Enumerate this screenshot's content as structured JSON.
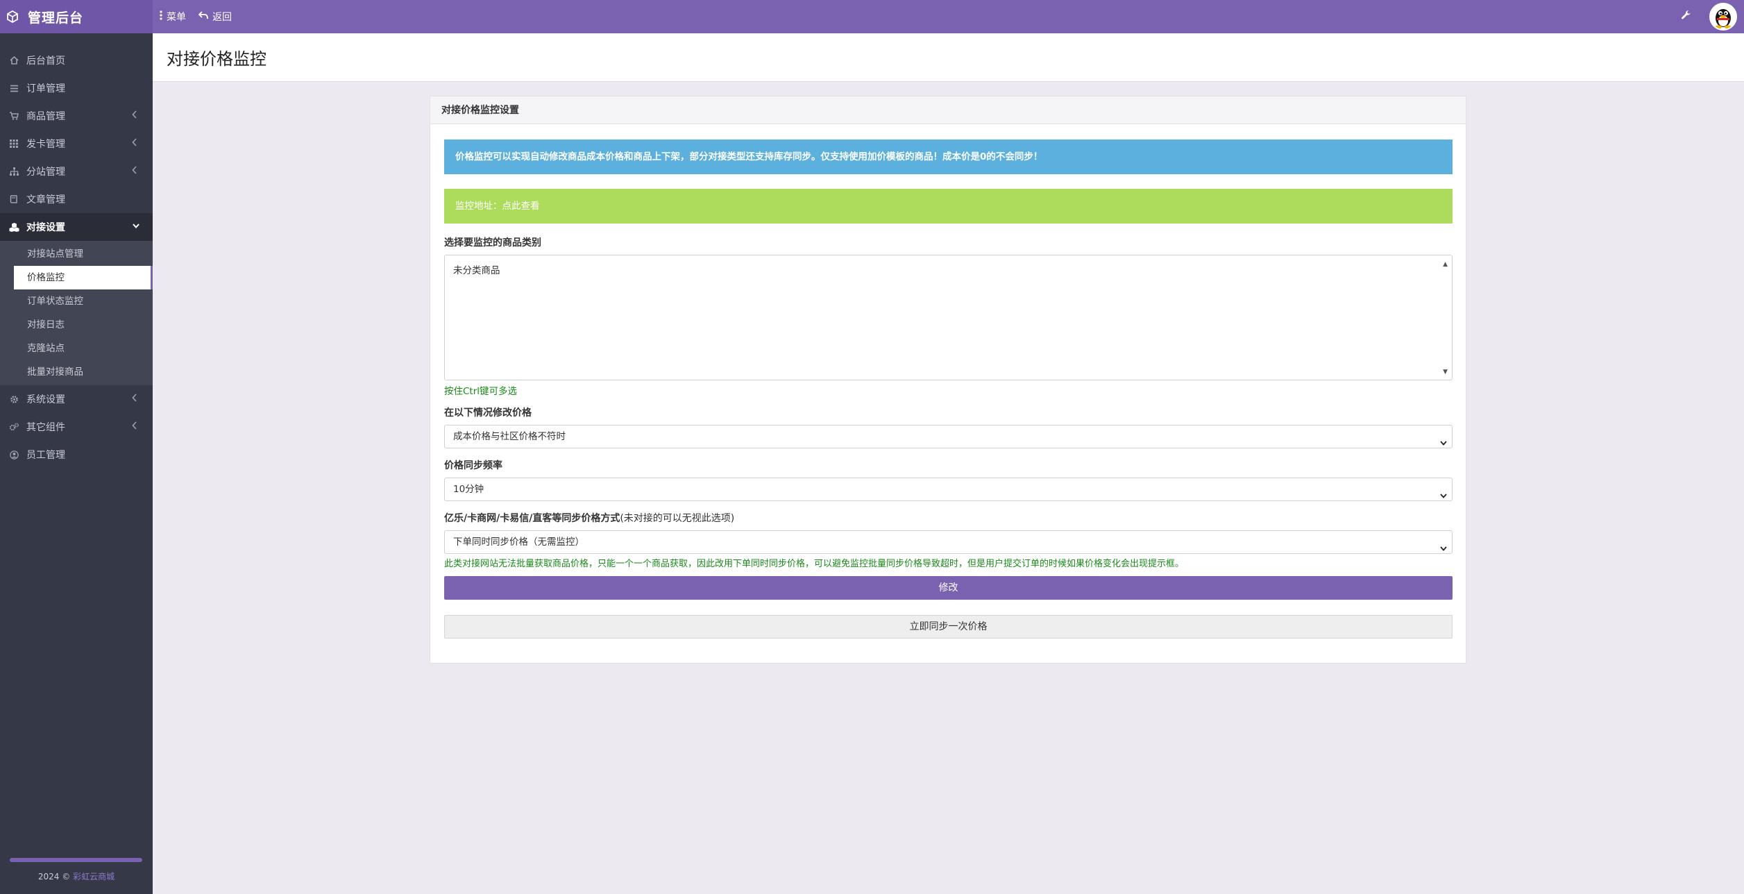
{
  "app": {
    "title": "管理后台",
    "topnav": {
      "menu": "菜单",
      "back": "返回"
    }
  },
  "sidebar": {
    "items": [
      {
        "label": "后台首页",
        "icon": "home-icon"
      },
      {
        "label": "订单管理",
        "icon": "list-icon"
      },
      {
        "label": "商品管理",
        "icon": "cart-icon"
      },
      {
        "label": "发卡管理",
        "icon": "grid-icon"
      },
      {
        "label": "分站管理",
        "icon": "sitemap-icon"
      },
      {
        "label": "文章管理",
        "icon": "book-icon"
      },
      {
        "label": "对接设置",
        "icon": "cubes-icon"
      },
      {
        "label": "系统设置",
        "icon": "gear-icon"
      },
      {
        "label": "其它组件",
        "icon": "cogs-icon"
      },
      {
        "label": "员工管理",
        "icon": "user-icon"
      }
    ],
    "sub_items": [
      {
        "label": "对接站点管理"
      },
      {
        "label": "价格监控"
      },
      {
        "label": "订单状态监控"
      },
      {
        "label": "对接日志"
      },
      {
        "label": "克隆站点"
      },
      {
        "label": "批量对接商品"
      }
    ],
    "footer": {
      "year": "2024 ©",
      "link": "彩虹云商城"
    }
  },
  "page": {
    "title": "对接价格监控"
  },
  "panel": {
    "heading": "对接价格监控设置",
    "info_alert": "价格监控可以实现自动修改商品成本价格和商品上下架，部分对接类型还支持库存同步。仅支持使用加价模板的商品！成本价是0的不会同步！",
    "monitor_label": "监控地址：",
    "monitor_link": "点此查看",
    "category_label": "选择要监控的商品类别",
    "category_option": "未分类商品",
    "category_help": "按住Ctrl键可多选",
    "modify_label": "在以下情况修改价格",
    "modify_value": "成本价格与社区价格不符时",
    "freq_label": "价格同步频率",
    "freq_value": "10分钟",
    "sync_label": "亿乐/卡商网/卡易信/直客等同步价格方式",
    "sync_label_note": "(未对接的可以无视此选项)",
    "sync_value": "下单同时同步价格（无需监控）",
    "sync_help": "此类对接网站无法批量获取商品价格，只能一个一个商品获取，因此改用下单同时同步价格，可以避免监控批量同步价格导致超时，但是用户提交订单的时候如果价格变化会出现提示框。",
    "submit_label": "修改",
    "sync_now_label": "立即同步一次价格"
  },
  "colors": {
    "primary": "#7b62b1",
    "sidebar": "#353847",
    "info": "#5cb0de",
    "success": "#addc5c",
    "help_text": "#1a8a1a"
  }
}
